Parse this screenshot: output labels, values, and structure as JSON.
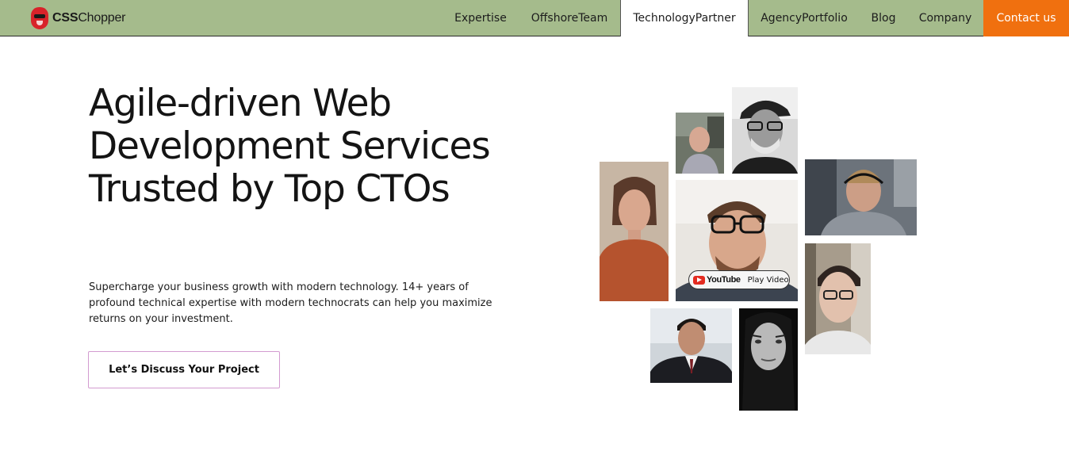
{
  "header": {
    "logo_text_bold": "CSS",
    "logo_text_regular": "Chopper",
    "nav": [
      {
        "label": "Expertise"
      },
      {
        "label": "OffshoreTeam"
      },
      {
        "label": "TechnologyPartner"
      },
      {
        "label": "AgencyPortfolio"
      },
      {
        "label": "Blog"
      },
      {
        "label": "Company"
      }
    ],
    "cta_label": "Contact us"
  },
  "hero": {
    "title": "Agile-driven Web Development Services Trusted by Top CTOs",
    "subtitle": "Supercharge your business growth with modern technology. 14+ years of profound technical expertise with modern technocrats can help you maximize returns on your investment.",
    "cta_label": "Let’s Discuss Your Project"
  },
  "video": {
    "platform": "YouTube",
    "play_label": "Play Video"
  },
  "colors": {
    "nav_bg": "#a5bb8c",
    "cta_bg": "#f0700f",
    "button_border": "#d39bd0"
  }
}
